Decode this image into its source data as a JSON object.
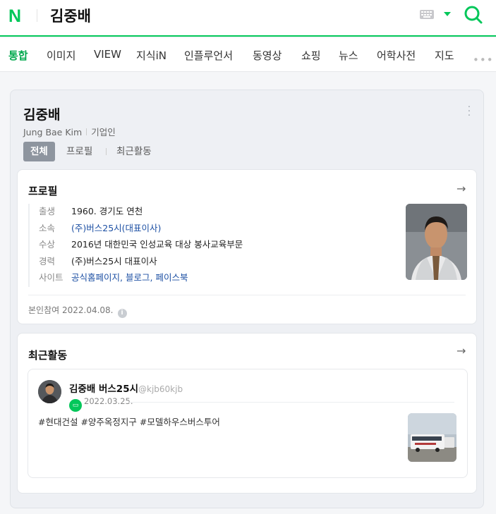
{
  "header": {
    "logo": "N",
    "query": "김중배"
  },
  "tabs": [
    "통합",
    "이미지",
    "VIEW",
    "지식iN",
    "인플루언서",
    "동영상",
    "쇼핑",
    "뉴스",
    "어학사전",
    "지도"
  ],
  "more": "•••",
  "profile": {
    "name": "김중배",
    "romanized": "Jung Bae Kim",
    "occupation": "기업인",
    "subtabs": [
      "전체",
      "프로필",
      "최근활동"
    ]
  },
  "profile_card": {
    "title": "프로필",
    "rows": [
      {
        "label": "출생",
        "value": "1960. 경기도 연천"
      },
      {
        "label": "소속",
        "value": "(주)버스25시(대표이사)"
      },
      {
        "label": "수상",
        "value": "2016년 대한민국 인성교육 대상 봉사교육부문"
      },
      {
        "label": "경력",
        "value": "(주)버스25시 대표이사"
      }
    ],
    "site_label": "사이트",
    "sites": [
      "공식홈페이지",
      "블로그",
      "페이스북"
    ],
    "footer": "본인참여 2022.04.08."
  },
  "activity_card": {
    "title": "최근활동",
    "post": {
      "author": "김중배 버스25시",
      "handle": "@kjb60kjb",
      "date": "2022.03.25.",
      "text": "#현대건설 #양주옥정지구 #모델하우스버스투어"
    }
  },
  "colors": {
    "accent": "#03c75a",
    "link": "#1c4fa3"
  }
}
